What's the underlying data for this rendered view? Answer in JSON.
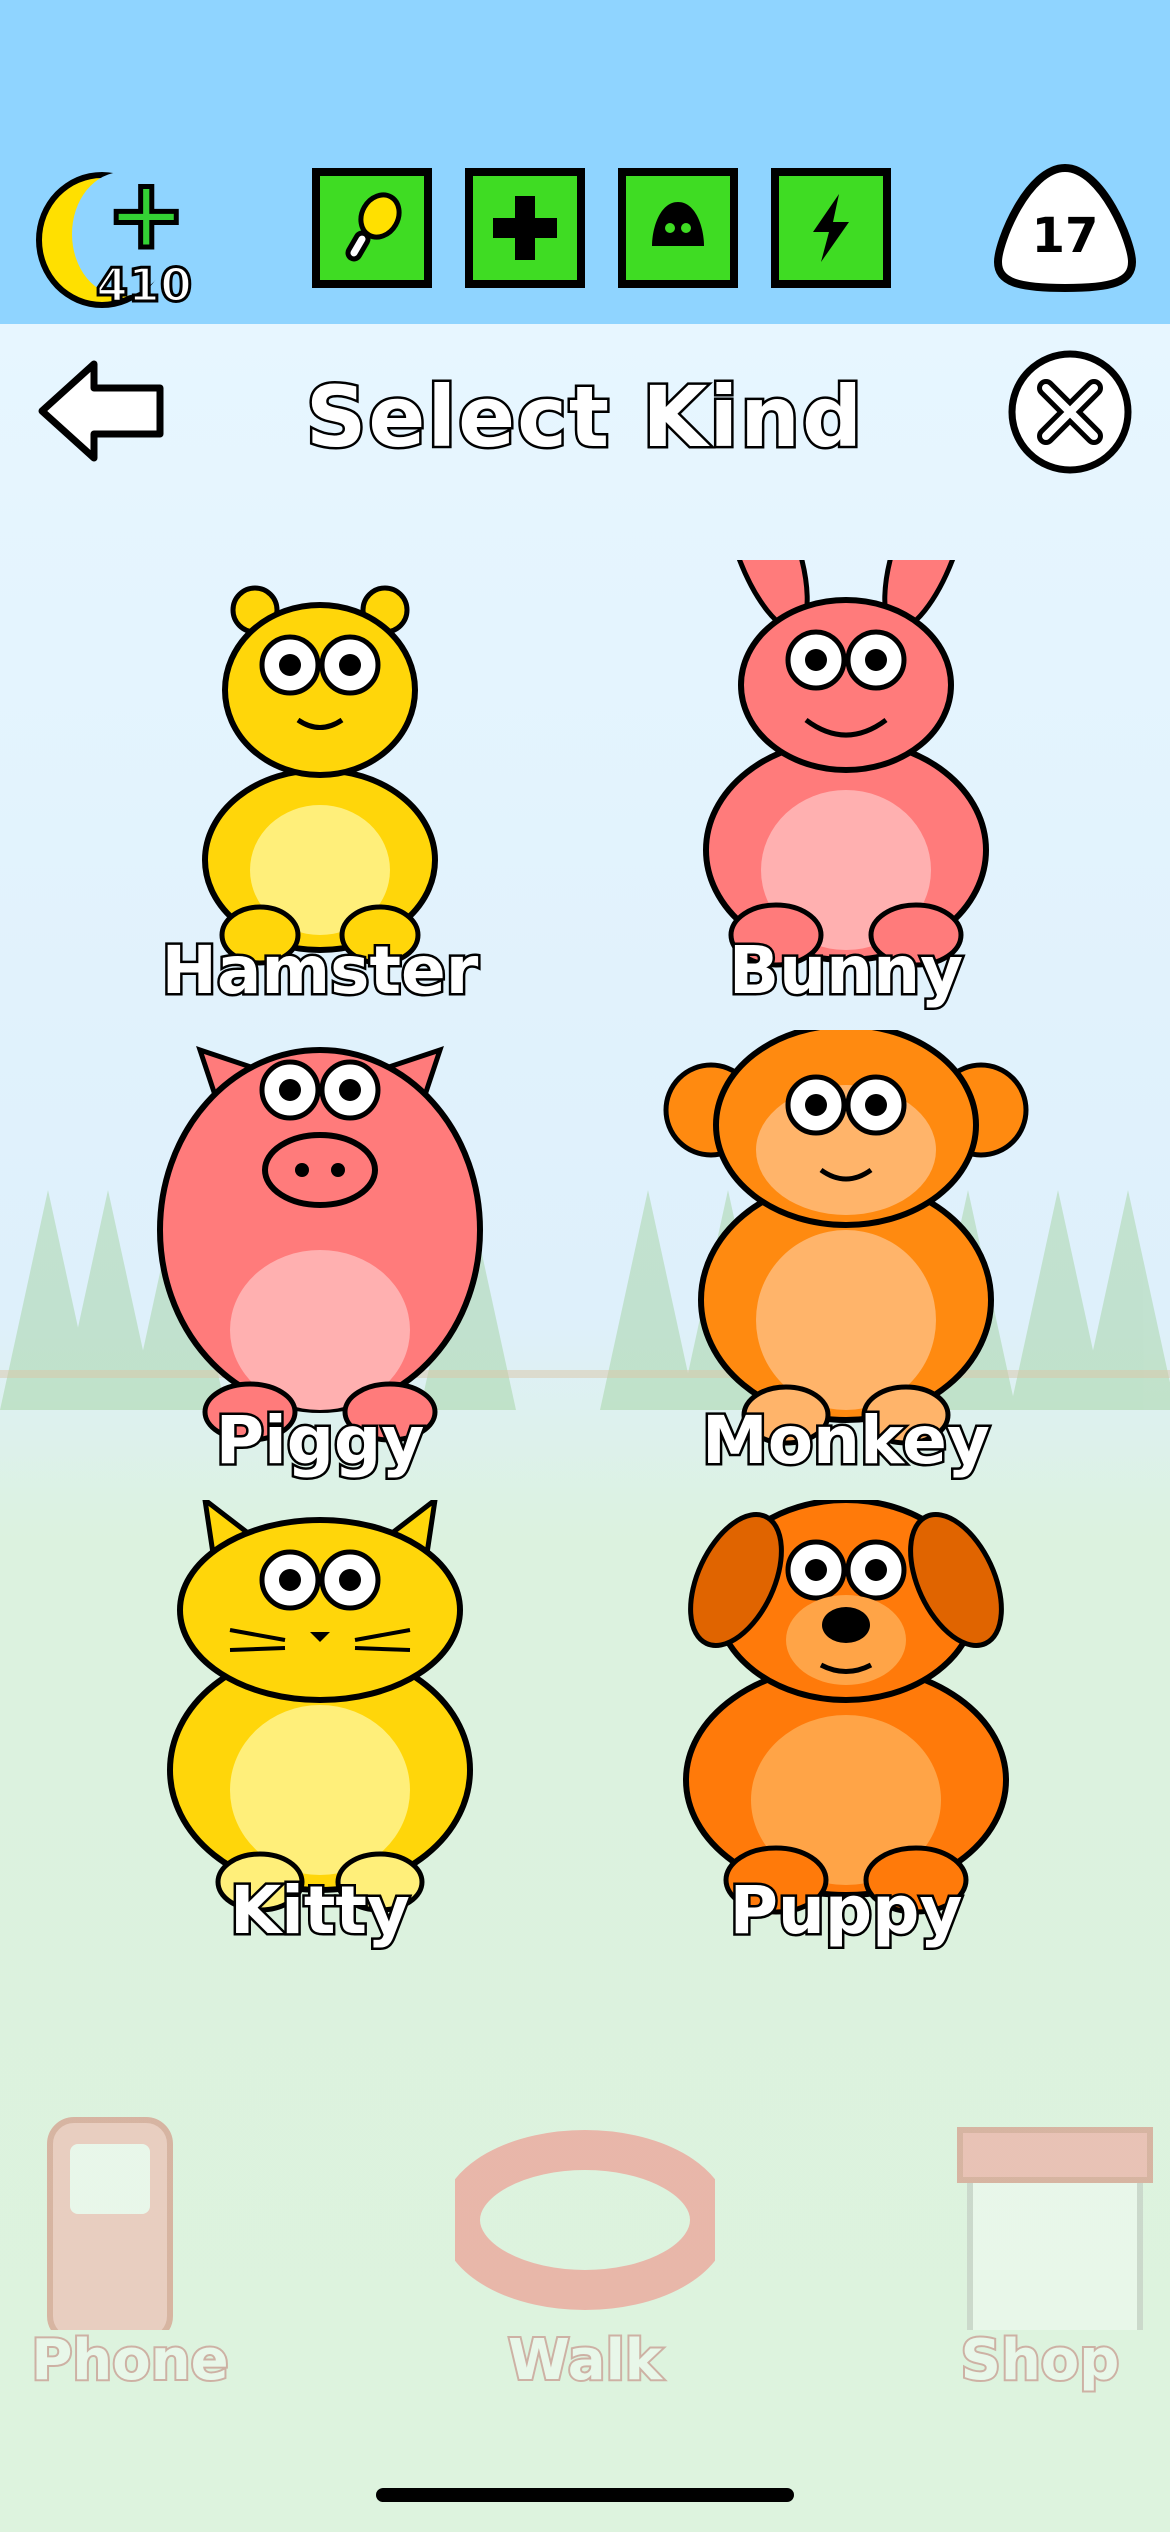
{
  "hud": {
    "coins": "410",
    "level": "17",
    "stat_buttons": [
      {
        "icon": "food-icon"
      },
      {
        "icon": "health-icon"
      },
      {
        "icon": "clean-icon"
      },
      {
        "icon": "energy-icon"
      }
    ]
  },
  "header": {
    "title": "Select Kind"
  },
  "pets": [
    {
      "label": "Hamster",
      "color": "#ffd60a"
    },
    {
      "label": "Bunny",
      "color": "#ff7b7b"
    },
    {
      "label": "Piggy",
      "color": "#ff7b7b"
    },
    {
      "label": "Monkey",
      "color": "#ff8a10"
    },
    {
      "label": "Kitty",
      "color": "#ffd60a"
    },
    {
      "label": "Puppy",
      "color": "#ff7a0a"
    }
  ],
  "bottom_nav": [
    {
      "label": "Phone"
    },
    {
      "label": "Walk"
    },
    {
      "label": "Shop"
    }
  ]
}
